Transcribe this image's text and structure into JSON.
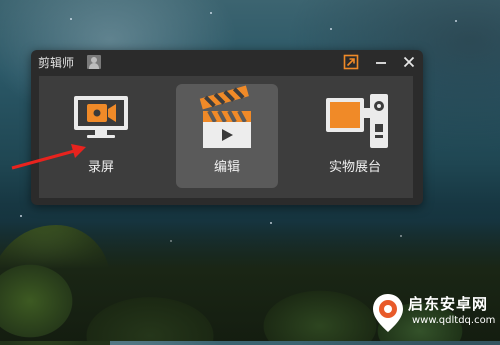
{
  "window": {
    "title": "剪辑师",
    "controls": [
      "restore-icon",
      "minimize-icon",
      "close-icon"
    ]
  },
  "tiles": [
    {
      "label": "录屏",
      "icon": "screen-record-icon",
      "selected": false
    },
    {
      "label": "编辑",
      "icon": "clapperboard-icon",
      "selected": true
    },
    {
      "label": "实物展台",
      "icon": "document-camera-icon",
      "selected": false
    }
  ],
  "watermark": {
    "title": "启东安卓网",
    "url": "www.qdltdq.com"
  },
  "colors": {
    "accent_orange": "#f08a28",
    "window_bg": "#2b2b2b",
    "panel_bg": "#3d3d3d",
    "selected_tile_bg": "#5a5a5a",
    "annotation_red": "#e8231e"
  }
}
